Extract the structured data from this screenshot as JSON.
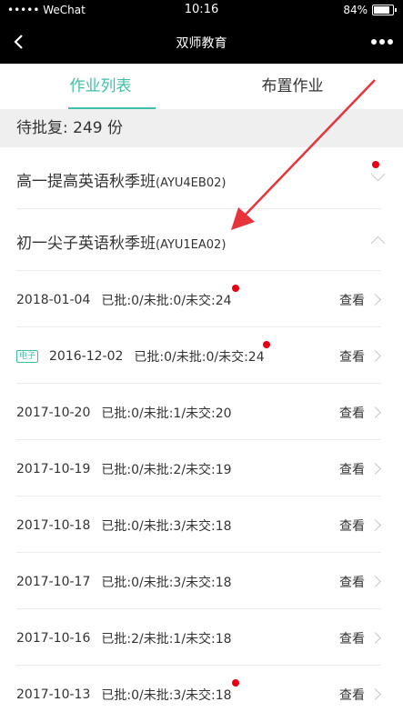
{
  "status": {
    "carrier": "••••• WeChat",
    "time": "10:16",
    "battery": "84%"
  },
  "nav": {
    "title": "双师教育"
  },
  "tabs": [
    {
      "label": "作业列表",
      "active": true
    },
    {
      "label": "布置作业",
      "active": false
    }
  ],
  "pending": "待批复: 249 份",
  "classes": [
    {
      "name": "高一提高英语秋季班",
      "code": "(AYU4EB02)",
      "expanded": false,
      "has_dot": true
    },
    {
      "name": "初一尖子英语秋季班",
      "code": "(AYU1EA02)",
      "expanded": true,
      "has_dot": false
    }
  ],
  "homework": [
    {
      "tag": "",
      "date": "2018-01-04",
      "stats": "已批:0/未批:0/未交:24",
      "view": "查看",
      "has_dot": true
    },
    {
      "tag": "电子",
      "date": "2016-12-02",
      "stats": "已批:0/未批:0/未交:24",
      "view": "查看",
      "has_dot": true
    },
    {
      "tag": "",
      "date": "2017-10-20",
      "stats": "已批:0/未批:1/未交:20",
      "view": "查看",
      "has_dot": false
    },
    {
      "tag": "",
      "date": "2017-10-19",
      "stats": "已批:0/未批:2/未交:19",
      "view": "查看",
      "has_dot": false
    },
    {
      "tag": "",
      "date": "2017-10-18",
      "stats": "已批:0/未批:3/未交:18",
      "view": "查看",
      "has_dot": false
    },
    {
      "tag": "",
      "date": "2017-10-17",
      "stats": "已批:0/未批:3/未交:18",
      "view": "查看",
      "has_dot": false
    },
    {
      "tag": "",
      "date": "2017-10-16",
      "stats": "已批:2/未批:1/未交:18",
      "view": "查看",
      "has_dot": false
    },
    {
      "tag": "",
      "date": "2017-10-13",
      "stats": "已批:0/未批:3/未交:18",
      "view": "查看",
      "has_dot": true
    }
  ],
  "colors": {
    "accent": "#3fbfa8",
    "dot": "#e60012",
    "annotation_arrow": "#e8333a"
  }
}
